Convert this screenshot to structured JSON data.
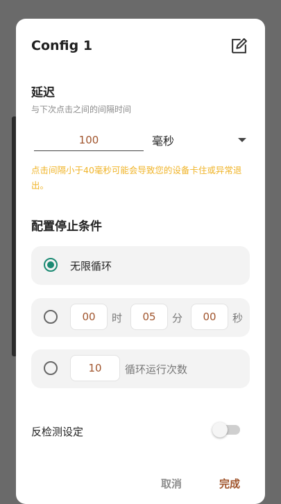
{
  "dialog": {
    "title": "Config 1",
    "edit_icon": "edit-icon",
    "delay": {
      "heading": "延迟",
      "subtitle": "与下次点击之间的间隔时间",
      "value": "100",
      "unit": "毫秒",
      "warning": "点击间隔小于40毫秒可能会导致您的设备卡住或异常退出。"
    },
    "stop": {
      "heading": "配置停止条件",
      "options": [
        {
          "label": "无限循环",
          "selected": true
        },
        {
          "hours": "00",
          "hours_unit": "时",
          "minutes": "05",
          "minutes_unit": "分",
          "seconds": "00",
          "seconds_unit": "秒",
          "selected": false
        },
        {
          "count": "10",
          "label": "循环运行次数",
          "selected": false
        }
      ]
    },
    "anti_detect": {
      "label": "反检测设定",
      "enabled": false
    },
    "buttons": {
      "cancel": "取消",
      "ok": "完成"
    }
  },
  "colors": {
    "accent": "#1b8a73",
    "value": "#a0542c",
    "warning": "#f0b429"
  }
}
